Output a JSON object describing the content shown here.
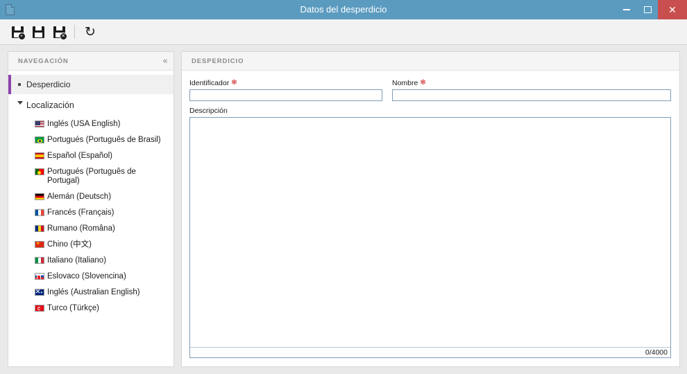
{
  "window": {
    "title": "Datos del desperdicio",
    "icon": "document-icon",
    "titlebar_color": "#5b9bc0",
    "controls": {
      "minimize": "minimize-icon",
      "maximize": "maximize-icon",
      "close_label": "✕"
    }
  },
  "toolbar": {
    "buttons": [
      {
        "name": "save-and-new-button",
        "icon": "floppy-disk-icon",
        "badge": "+"
      },
      {
        "name": "save-button",
        "icon": "floppy-disk-icon",
        "badge": ""
      },
      {
        "name": "save-and-close-button",
        "icon": "floppy-disk-icon",
        "badge": "✕"
      }
    ],
    "refresh": {
      "name": "refresh-button",
      "icon": "refresh-icon",
      "glyph": "↻"
    }
  },
  "sidebar": {
    "header_title": "NAVEGACIÓN",
    "collapse_icon": "«",
    "root_item": {
      "label": "Desperdicio",
      "selected": true,
      "accent_color": "#8e44ad"
    },
    "group": {
      "label": "Localización",
      "expanded": true
    },
    "languages": [
      {
        "label": "Inglés (USA English)",
        "flag": "flag-us",
        "flag_name": "flag-icon-usa"
      },
      {
        "label": "Portugués (Português de Brasil)",
        "flag": "flag-br",
        "flag_name": "flag-icon-brazil"
      },
      {
        "label": "Español (Español)",
        "flag": "flag-es",
        "flag_name": "flag-icon-spain"
      },
      {
        "label": "Portugués (Português de Portugal)",
        "flag": "flag-pt",
        "flag_name": "flag-icon-portugal"
      },
      {
        "label": "Alemán (Deutsch)",
        "flag": "flag-de",
        "flag_name": "flag-icon-germany"
      },
      {
        "label": "Francés (Français)",
        "flag": "flag-fr",
        "flag_name": "flag-icon-france"
      },
      {
        "label": "Rumano (Româna)",
        "flag": "flag-ro",
        "flag_name": "flag-icon-romania"
      },
      {
        "label": "Chino (中文)",
        "flag": "flag-cn",
        "flag_name": "flag-icon-china"
      },
      {
        "label": "Italiano (Italiano)",
        "flag": "flag-it",
        "flag_name": "flag-icon-italy"
      },
      {
        "label": "Eslovaco (Slovencina)",
        "flag": "flag-sk",
        "flag_name": "flag-icon-slovakia"
      },
      {
        "label": "Inglés (Australian English)",
        "flag": "flag-au",
        "flag_name": "flag-icon-australia"
      },
      {
        "label": "Turco (Türkçe)",
        "flag": "flag-tr",
        "flag_name": "flag-icon-turkey"
      }
    ]
  },
  "content": {
    "header_title": "DESPERDICIO",
    "fields": {
      "identificador": {
        "label": "Identificador",
        "required": true,
        "required_marker": "✻",
        "value": "",
        "placeholder": ""
      },
      "nombre": {
        "label": "Nombre",
        "required": true,
        "required_marker": "✻",
        "value": "",
        "placeholder": ""
      },
      "descripcion": {
        "label": "Descripción",
        "required": false,
        "value": "",
        "placeholder": "",
        "counter": "0/4000",
        "maxlength": 4000
      }
    }
  }
}
